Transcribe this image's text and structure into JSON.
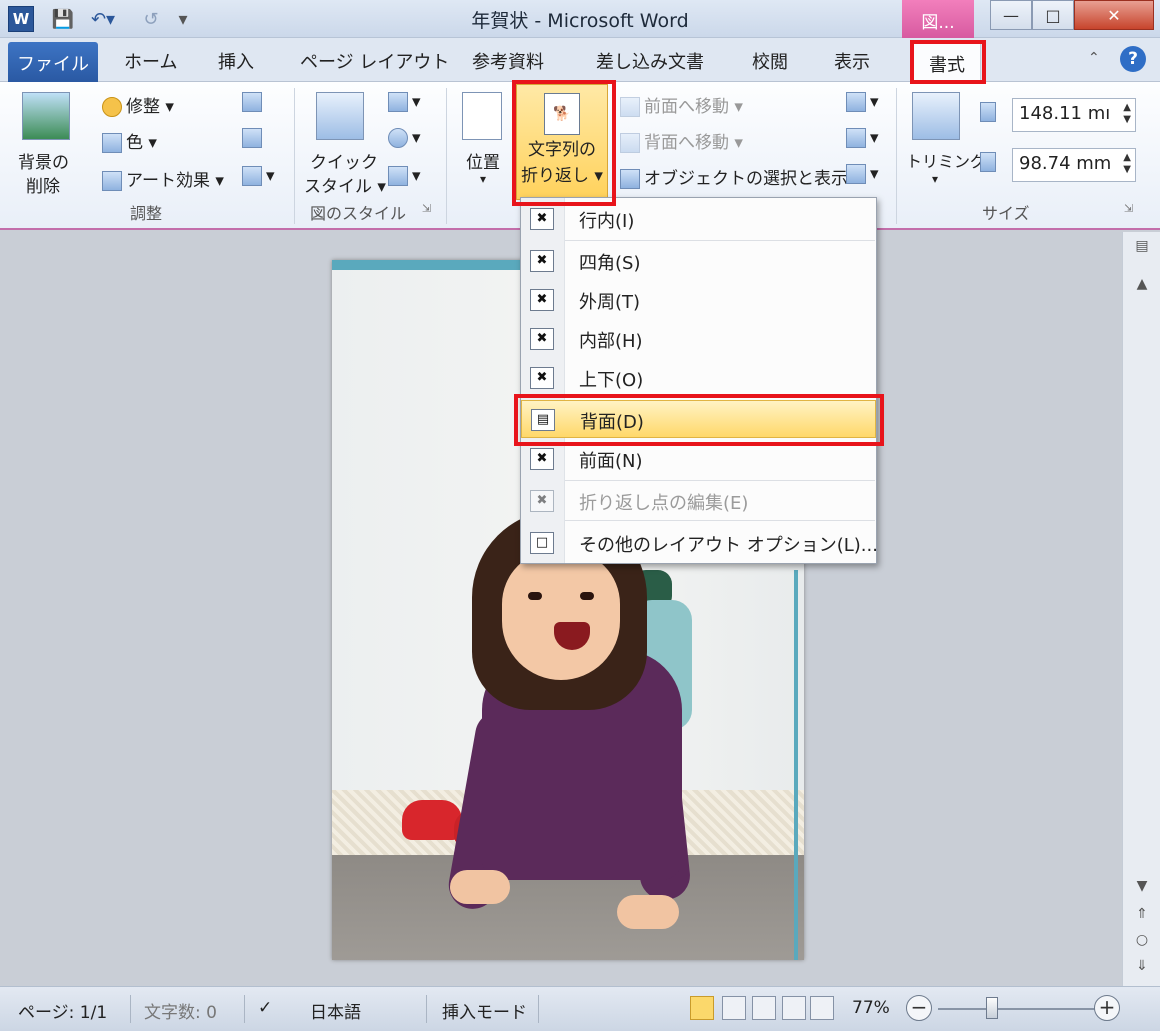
{
  "window": {
    "title": "年賀状 - Microsoft Word",
    "context_tab": "図...",
    "app_icon_letter": "W"
  },
  "tabs": [
    {
      "label": "ファイル"
    },
    {
      "label": "ホーム"
    },
    {
      "label": "挿入"
    },
    {
      "label": "ページ レイアウト"
    },
    {
      "label": "参考資料"
    },
    {
      "label": "差し込み文書"
    },
    {
      "label": "校閲"
    },
    {
      "label": "表示"
    },
    {
      "label": "書式"
    }
  ],
  "ribbon": {
    "adjust": {
      "remove_bg_line1": "背景の",
      "remove_bg_line2": "削除",
      "corrections": "修整",
      "color": "色",
      "art_effects": "アート効果",
      "label": "調整"
    },
    "styles": {
      "quick_line1": "クイック",
      "quick_line2": "スタイル",
      "label": "図のスタイル"
    },
    "arrange": {
      "position": "位置",
      "wrap_line1": "文字列の",
      "wrap_line2": "折り返し",
      "bring_forward": "前面へ移動",
      "send_backward": "背面へ移動",
      "selection_pane": "オブジェクトの選択と表示"
    },
    "size": {
      "crop": "トリミング",
      "height": "148.11 mı",
      "width": "98.74 mm",
      "label": "サイズ"
    }
  },
  "wrap_menu": [
    {
      "label": "行内(I)",
      "state": "normal"
    },
    {
      "label": "四角(S)",
      "state": "normal"
    },
    {
      "label": "外周(T)",
      "state": "normal"
    },
    {
      "label": "内部(H)",
      "state": "normal"
    },
    {
      "label": "上下(O)",
      "state": "normal"
    },
    {
      "label": "背面(D)",
      "state": "highlighted"
    },
    {
      "label": "前面(N)",
      "state": "normal"
    },
    {
      "label": "折り返し点の編集(E)",
      "state": "disabled"
    },
    {
      "label": "その他のレイアウト オプション(L)...",
      "state": "normal"
    }
  ],
  "status": {
    "page": "ページ: 1/1",
    "words": "文字数: 0",
    "language": "日本語",
    "mode": "挿入モード",
    "zoom": "77%"
  },
  "colors": {
    "highlight_red": "#e8141b",
    "menu_hover": "#ffd86a",
    "context_pink": "#d75aa0"
  }
}
